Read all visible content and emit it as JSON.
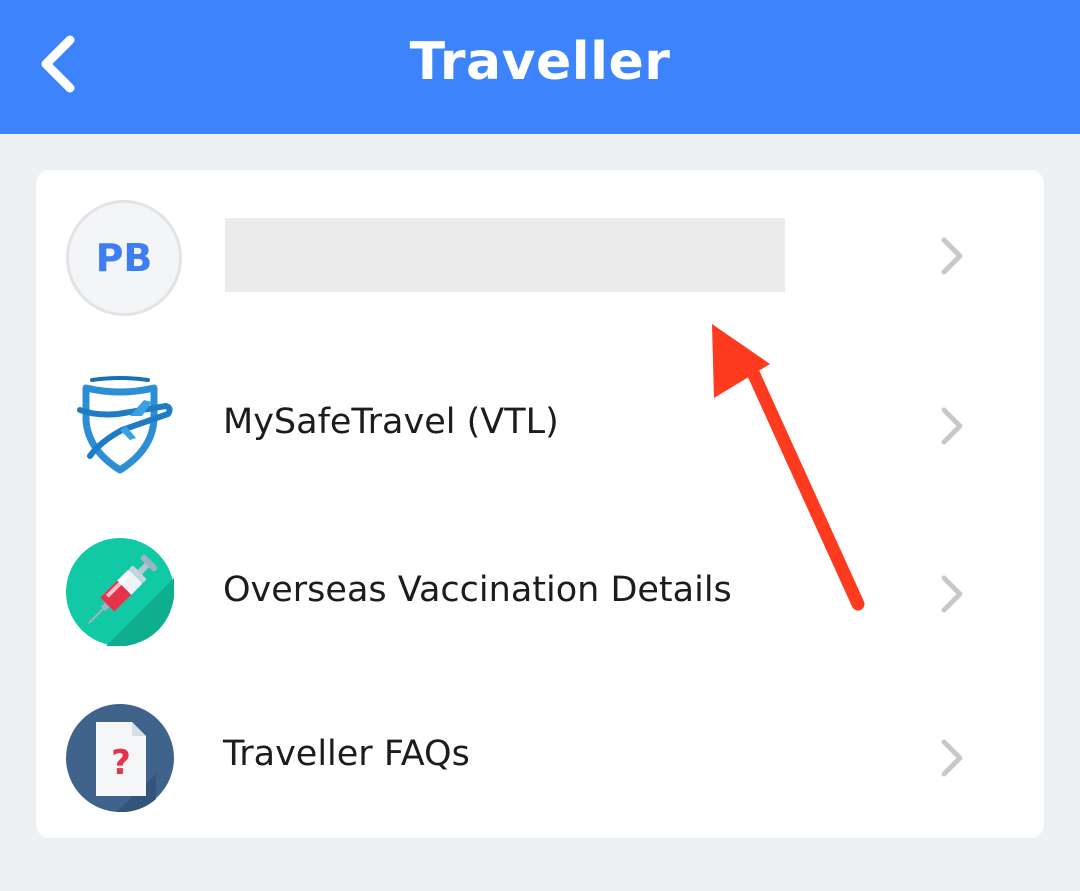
{
  "header": {
    "title": "Traveller",
    "back_icon": "chevron-left-icon"
  },
  "profile": {
    "initials": "PB",
    "name_redacted": true
  },
  "menu": {
    "items": [
      {
        "label": "MySafeTravel (VTL)",
        "icon": "shield-plane-icon"
      },
      {
        "label": "Overseas Vaccination Details",
        "icon": "syringe-icon"
      },
      {
        "label": "Traveller FAQs",
        "icon": "faq-document-icon"
      }
    ]
  },
  "colors": {
    "header_bg": "#3d84fc",
    "page_bg": "#edf0f2",
    "card_bg": "#ffffff",
    "initials": "#3d7ef0",
    "chevron": "#c7c7cc",
    "annotation_arrow": "#ff3b1f"
  }
}
